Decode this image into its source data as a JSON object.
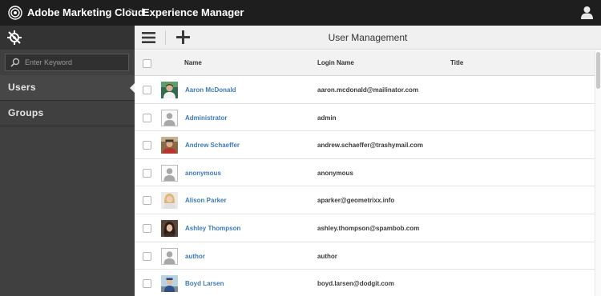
{
  "header": {
    "brand": "Adobe Marketing Cloud",
    "separator": ">",
    "product": "Experience Manager"
  },
  "sidebar": {
    "search_placeholder": "Enter Keyword",
    "items": [
      {
        "label": "Users",
        "active": true
      },
      {
        "label": "Groups",
        "active": false
      }
    ]
  },
  "toolbar": {
    "title": "User Management"
  },
  "table": {
    "columns": {
      "name": "Name",
      "login": "Login Name",
      "title": "Title"
    },
    "rows": [
      {
        "name": "Aaron McDonald",
        "login": "aaron.mcdonald@mailinator.com",
        "title": "",
        "avatar": "photo"
      },
      {
        "name": "Administrator",
        "login": "admin",
        "title": "",
        "avatar": "placeholder"
      },
      {
        "name": "Andrew Schaeffer",
        "login": "andrew.schaeffer@trashymail.com",
        "title": "",
        "avatar": "photo"
      },
      {
        "name": "anonymous",
        "login": "anonymous",
        "title": "",
        "avatar": "placeholder"
      },
      {
        "name": "Alison Parker",
        "login": "aparker@geometrixx.info",
        "title": "",
        "avatar": "photo"
      },
      {
        "name": "Ashley Thompson",
        "login": "ashley.thompson@spambob.com",
        "title": "",
        "avatar": "photo"
      },
      {
        "name": "author",
        "login": "author",
        "title": "",
        "avatar": "placeholder"
      },
      {
        "name": "Boyd Larsen",
        "login": "boyd.larsen@dodgit.com",
        "title": "",
        "avatar": "photo"
      }
    ]
  },
  "colors": {
    "topbar": "#1e1e1e",
    "sidebar": "#404040",
    "link": "#3d7ab8"
  }
}
